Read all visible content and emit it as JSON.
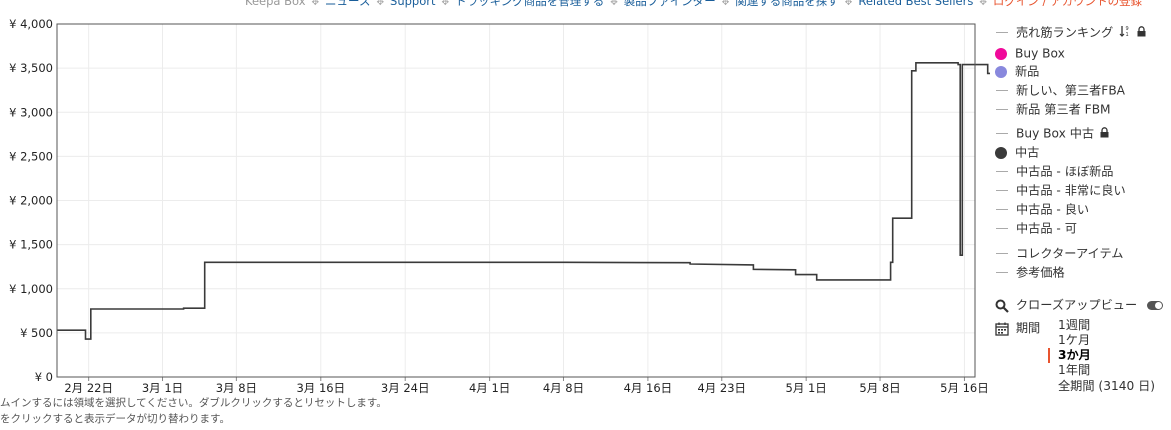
{
  "nav": {
    "items": [
      {
        "label": "Keepa Box",
        "kind": "plain"
      },
      {
        "label": "ニュース",
        "kind": "link"
      },
      {
        "label": "Support",
        "kind": "link"
      },
      {
        "label": "トラッキング商品を管理する",
        "kind": "link"
      },
      {
        "label": "製品ファインダー",
        "kind": "link"
      },
      {
        "label": "関連する商品を探す",
        "kind": "link"
      },
      {
        "label": "Related Best Sellers",
        "kind": "link"
      },
      {
        "label": "ログイン / アカウントの登録",
        "kind": "login"
      }
    ],
    "separator": "✥"
  },
  "chart_data": {
    "type": "line",
    "title": "",
    "xlabel": "",
    "ylabel": "",
    "x_ticks": [
      "2月 22日",
      "3月 1日",
      "3月 8日",
      "3月 16日",
      "3月 24日",
      "4月 1日",
      "4月 8日",
      "4月 16日",
      "4月 23日",
      "5月 1日",
      "5月 8日",
      "5月 16日"
    ],
    "y_ticks": [
      "¥ 0",
      "¥ 500",
      "¥ 1,000",
      "¥ 1,500",
      "¥ 2,000",
      "¥ 2,500",
      "¥ 3,000",
      "¥ 3,500",
      "¥ 4,000"
    ],
    "ylim": [
      0,
      4000
    ],
    "xlim_days": [
      -3,
      84
    ],
    "x_origin_date": "2月 22日",
    "grid": true,
    "legend_position": "right",
    "series": [
      {
        "name": "中古",
        "color": "#3a3a3a",
        "step": true,
        "points": [
          {
            "d": -3,
            "v": 530
          },
          {
            "d": -0.3,
            "v": 530
          },
          {
            "d": -0.3,
            "v": 430
          },
          {
            "d": 0.2,
            "v": 430
          },
          {
            "d": 0.2,
            "v": 770
          },
          {
            "d": 9,
            "v": 770
          },
          {
            "d": 9,
            "v": 780
          },
          {
            "d": 11,
            "v": 780
          },
          {
            "d": 11,
            "v": 1300
          },
          {
            "d": 45,
            "v": 1300
          },
          {
            "d": 57,
            "v": 1295
          },
          {
            "d": 57,
            "v": 1280
          },
          {
            "d": 63,
            "v": 1270
          },
          {
            "d": 63,
            "v": 1220
          },
          {
            "d": 67,
            "v": 1215
          },
          {
            "d": 67,
            "v": 1160
          },
          {
            "d": 69,
            "v": 1160
          },
          {
            "d": 69,
            "v": 1100
          },
          {
            "d": 76,
            "v": 1100
          },
          {
            "d": 76,
            "v": 1300
          },
          {
            "d": 76.2,
            "v": 1300
          },
          {
            "d": 76.2,
            "v": 1800
          },
          {
            "d": 78,
            "v": 1800
          },
          {
            "d": 78,
            "v": 3470
          },
          {
            "d": 78.4,
            "v": 3470
          },
          {
            "d": 78.4,
            "v": 3560
          },
          {
            "d": 82.4,
            "v": 3560
          },
          {
            "d": 82.4,
            "v": 3540
          },
          {
            "d": 82.6,
            "v": 3540
          },
          {
            "d": 82.6,
            "v": 1380
          },
          {
            "d": 82.8,
            "v": 1380
          },
          {
            "d": 82.8,
            "v": 3540
          },
          {
            "d": 85.2,
            "v": 3540
          },
          {
            "d": 85.2,
            "v": 3440
          },
          {
            "d": 86.2,
            "v": 3440
          }
        ]
      }
    ]
  },
  "legend": {
    "items": [
      {
        "label": "売れ筋ランキング",
        "marker": "dash",
        "color": "#aaaaaa",
        "extra": "sort-lock"
      },
      {
        "label": "Buy Box",
        "marker": "dot",
        "color": "#f0099a"
      },
      {
        "label": "新品",
        "marker": "dot",
        "color": "#8888dd"
      },
      {
        "label": "新しい、第三者FBA",
        "marker": "dash",
        "color": "#aaaaaa"
      },
      {
        "label": "新品 第三者 FBM",
        "marker": "dash",
        "color": "#aaaaaa"
      },
      {
        "label": "Buy Box 中古",
        "marker": "dash",
        "color": "#aaaaaa",
        "extra": "lock"
      },
      {
        "label": "中古",
        "marker": "dot",
        "color": "#3a3a3a"
      },
      {
        "label": "中古品 - ほぼ新品",
        "marker": "dash",
        "color": "#aaaaaa"
      },
      {
        "label": "中古品 - 非常に良い",
        "marker": "dash",
        "color": "#aaaaaa"
      },
      {
        "label": "中古品 - 良い",
        "marker": "dash",
        "color": "#aaaaaa"
      },
      {
        "label": "中古品 - 可",
        "marker": "dash",
        "color": "#aaaaaa"
      },
      {
        "label": "コレクターアイテム",
        "marker": "dash",
        "color": "#aaaaaa"
      },
      {
        "label": "参考価格",
        "marker": "dash",
        "color": "#aaaaaa"
      }
    ]
  },
  "closeup": {
    "label": "クローズアップビュー",
    "enabled": true
  },
  "period": {
    "label": "期間",
    "options": [
      "1週間",
      "1ケ月",
      "3か月",
      "1年間",
      "全期間 (3140 日)"
    ],
    "selected": "3か月"
  },
  "help": {
    "line1": "ムインするには領域を選択してください。ダブルクリックするとリセットします。",
    "line2": "をクリックすると表示データが切り替わります。"
  }
}
